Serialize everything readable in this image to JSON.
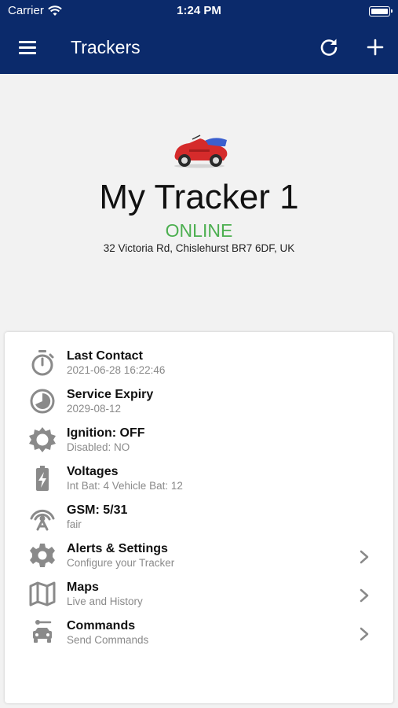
{
  "status_bar": {
    "carrier": "Carrier",
    "time": "1:24 PM"
  },
  "nav": {
    "title": "Trackers"
  },
  "tracker": {
    "name": "My Tracker 1",
    "status": "ONLINE",
    "address": "32 Victoria Rd, Chislehurst BR7 6DF, UK"
  },
  "rows": [
    {
      "title": "Last Contact",
      "subtitle": "2021-06-28 16:22:46",
      "icon": "stopwatch-icon"
    },
    {
      "title": "Service Expiry",
      "subtitle": "2029-08-12",
      "icon": "expiry-clock-icon"
    },
    {
      "title": "Ignition: OFF",
      "subtitle": "Disabled: NO",
      "icon": "sun-icon"
    },
    {
      "title": "Voltages",
      "subtitle": "Int Bat: 4 Vehicle Bat: 12",
      "icon": "battery-charging-icon"
    },
    {
      "title": "GSM: 5/31",
      "subtitle": "fair",
      "icon": "antenna-icon"
    },
    {
      "title": "Alerts & Settings",
      "subtitle": "Configure your Tracker",
      "icon": "gear-icon"
    },
    {
      "title": "Maps",
      "subtitle": "Live and History",
      "icon": "map-icon"
    },
    {
      "title": "Commands",
      "subtitle": "Send Commands",
      "icon": "car-command-icon"
    }
  ],
  "colors": {
    "header": "#0b2a6b",
    "online": "#4caf50",
    "icon_gray": "#8a8a8a"
  }
}
